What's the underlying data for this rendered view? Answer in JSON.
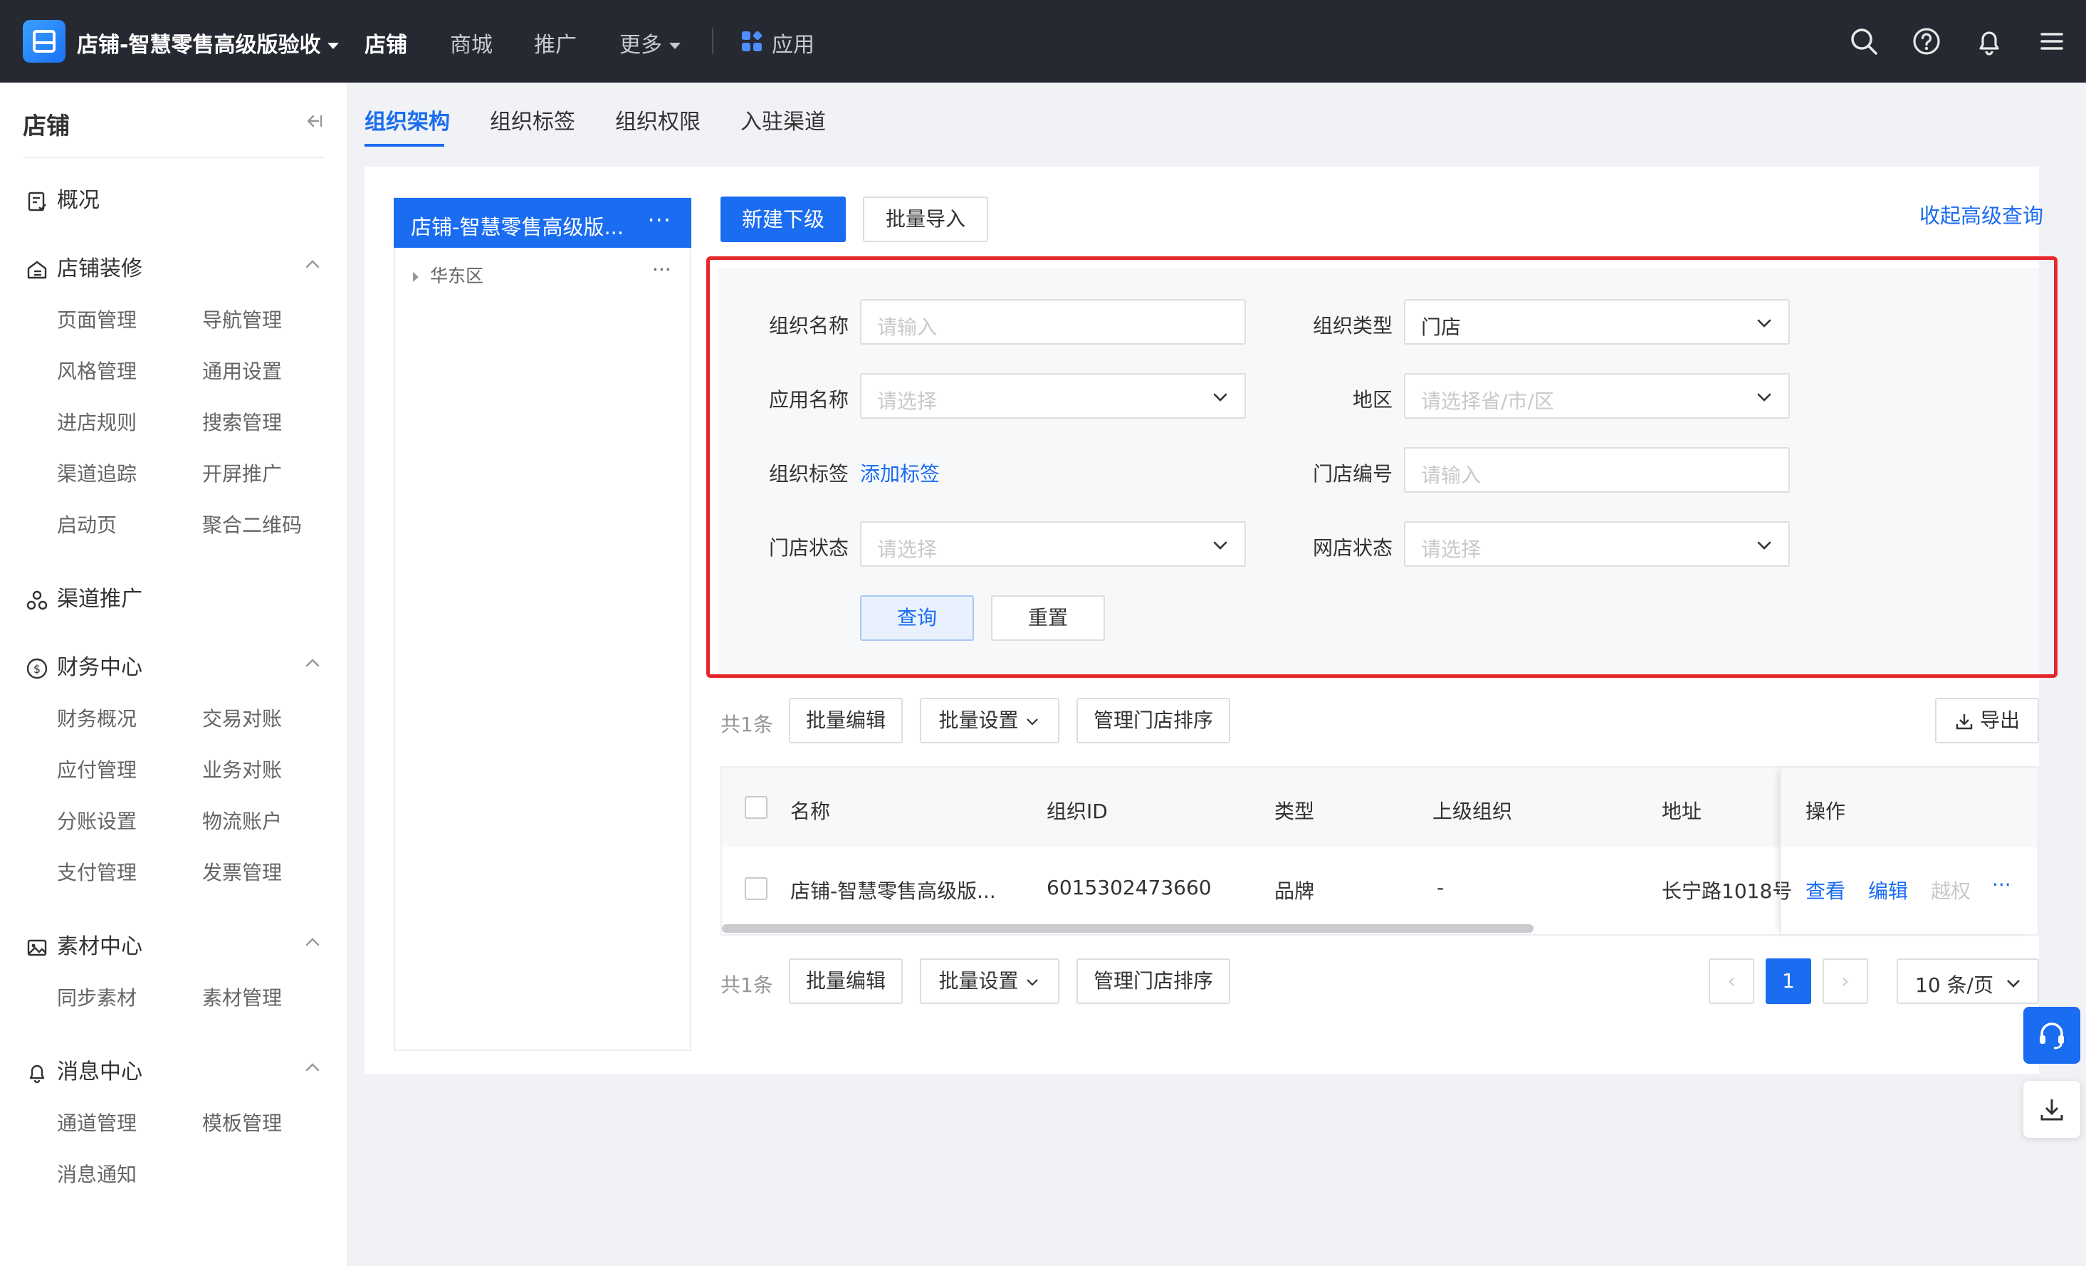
{
  "topbar": {
    "shop_name": "店铺-智慧零售高级版验收",
    "nav": [
      "店铺",
      "商城",
      "推广",
      "更多",
      "应用"
    ]
  },
  "sidebar": {
    "title": "店铺",
    "overview": "概况",
    "groups": {
      "decoration": {
        "label": "店铺装修",
        "items": [
          "页面管理",
          "导航管理",
          "风格管理",
          "通用设置",
          "进店规则",
          "搜索管理",
          "渠道追踪",
          "开屏推广",
          "启动页",
          "聚合二维码"
        ]
      },
      "channel": {
        "label": "渠道推广"
      },
      "finance": {
        "label": "财务中心",
        "items": [
          "财务概况",
          "交易对账",
          "应付管理",
          "业务对账",
          "分账设置",
          "物流账户",
          "支付管理",
          "发票管理"
        ]
      },
      "material": {
        "label": "素材中心",
        "items": [
          "同步素材",
          "素材管理"
        ]
      },
      "message": {
        "label": "消息中心",
        "items": [
          "通道管理",
          "模板管理",
          "消息通知"
        ]
      }
    }
  },
  "tabs": [
    "组织架构",
    "组织标签",
    "组织权限",
    "入驻渠道"
  ],
  "tree": {
    "root": "店铺-智慧零售高级版...",
    "more": "···",
    "child": "华东区",
    "child_more": "···"
  },
  "toolbar": {
    "new_sub": "新建下级",
    "batch_import": "批量导入",
    "collapse_query": "收起高级查询"
  },
  "filters": {
    "org_name": {
      "label": "组织名称",
      "placeholder": "请输入"
    },
    "org_type": {
      "label": "组织类型",
      "value": "门店"
    },
    "app_name": {
      "label": "应用名称",
      "placeholder": "请选择"
    },
    "region": {
      "label": "地区",
      "placeholder": "请选择省/市/区"
    },
    "org_tag": {
      "label": "组织标签",
      "link": "添加标签"
    },
    "store_no": {
      "label": "门店编号",
      "placeholder": "请输入"
    },
    "store_status": {
      "label": "门店状态",
      "placeholder": "请选择"
    },
    "online_status": {
      "label": "网店状态",
      "placeholder": "请选择"
    },
    "query_btn": "查询",
    "reset_btn": "重置"
  },
  "actions": {
    "count": "共1条",
    "batch_edit": "批量编辑",
    "batch_settings": "批量设置",
    "manage_sort": "管理门店排序",
    "export": "导出"
  },
  "table": {
    "headers": [
      "名称",
      "组织ID",
      "类型",
      "上级组织",
      "地址",
      "操作"
    ],
    "rows": [
      {
        "name": "店铺-智慧零售高级版...",
        "id": "6015302473660",
        "type": "品牌",
        "parent": "-",
        "address": "长宁路1018号",
        "ops": [
          "查看",
          "编辑",
          "越权",
          "···"
        ]
      }
    ]
  },
  "pagination": {
    "current": "1",
    "page_size": "10 条/页",
    "prev": "‹",
    "next": "›"
  },
  "colors": {
    "primary": "#1a6cf0",
    "topbar": "#262931",
    "highlight": "#e4282b"
  }
}
